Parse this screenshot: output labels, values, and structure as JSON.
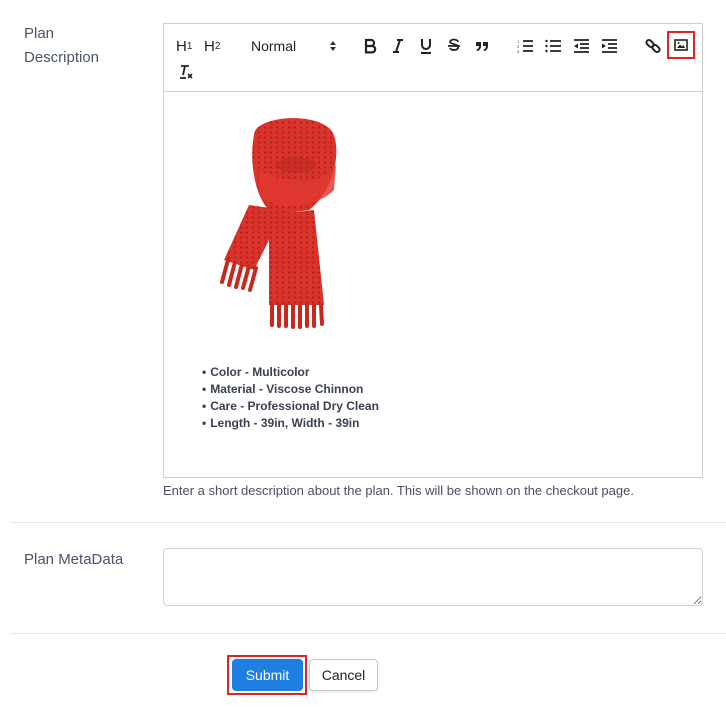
{
  "plan_description": {
    "label_line1": "Plan",
    "label_line2": "Description",
    "toolbar": {
      "h1": "H",
      "h1_sub": "1",
      "h2": "H",
      "h2_sub": "2",
      "format_select": "Normal",
      "icons": [
        "bold-icon",
        "italic-icon",
        "underline-icon",
        "strikethrough-icon",
        "blockquote-icon",
        "ordered-list-icon",
        "bullet-list-icon",
        "outdent-icon",
        "indent-icon",
        "link-icon",
        "image-icon",
        "clear-format-icon"
      ],
      "highlighted": "image-icon"
    },
    "content": {
      "image": "red knitted scarf",
      "bullets": [
        "Color - Multicolor",
        "Material - Viscose Chinnon",
        "Care - Professional Dry Clean",
        "Length - 39in, Width - 39in"
      ]
    },
    "help_text": "Enter a short description about the plan. This will be shown on the checkout page."
  },
  "plan_metadata": {
    "label": "Plan MetaData",
    "value": ""
  },
  "actions": {
    "submit_label": "Submit",
    "cancel_label": "Cancel"
  },
  "colors": {
    "primary": "#1e7fe0",
    "highlight": "#e02424",
    "scarf": "#d9332b"
  }
}
